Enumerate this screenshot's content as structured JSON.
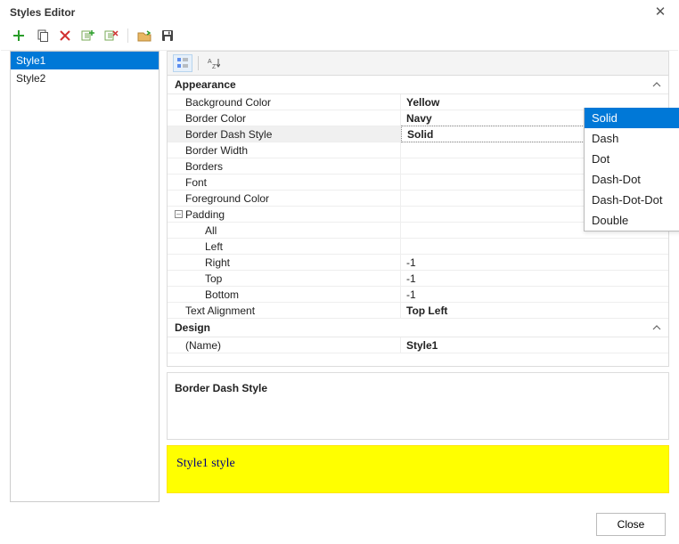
{
  "title": "Styles Editor",
  "close_btn": "Close",
  "styles": [
    "Style1",
    "Style2"
  ],
  "selected_style_index": 0,
  "categories": {
    "appearance": {
      "label": "Appearance",
      "rows": {
        "bg": {
          "name": "Background Color",
          "value": "Yellow"
        },
        "bc": {
          "name": "Border Color",
          "value": "Navy"
        },
        "bds": {
          "name": "Border Dash Style",
          "value": "Solid"
        },
        "bw": {
          "name": "Border Width",
          "value": ""
        },
        "bd": {
          "name": "Borders",
          "value": ""
        },
        "font": {
          "name": "Font",
          "value": ""
        },
        "fg": {
          "name": "Foreground Color",
          "value": ""
        },
        "pad": {
          "name": "Padding",
          "value": ""
        },
        "all": {
          "name": "All",
          "value": ""
        },
        "left": {
          "name": "Left",
          "value": ""
        },
        "right": {
          "name": "Right",
          "value": "-1"
        },
        "top": {
          "name": "Top",
          "value": "-1"
        },
        "bottom": {
          "name": "Bottom",
          "value": "-1"
        },
        "ta": {
          "name": "Text Alignment",
          "value": "Top Left"
        }
      }
    },
    "design": {
      "label": "Design",
      "rows": {
        "name": {
          "name": "(Name)",
          "value": "Style1"
        }
      }
    }
  },
  "dropdown": {
    "selected": "Solid",
    "options": [
      "Solid",
      "Dash",
      "Dot",
      "Dash-Dot",
      "Dash-Dot-Dot",
      "Double"
    ]
  },
  "description": {
    "title": "Border Dash Style",
    "body": ""
  },
  "preview_text": "Style1 style"
}
